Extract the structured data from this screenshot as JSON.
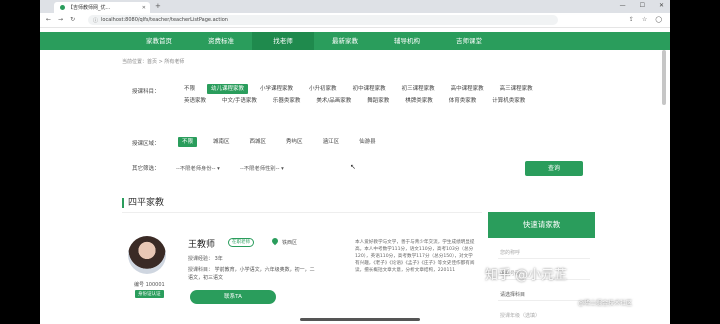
{
  "browser": {
    "tab_title": "【吉师教师网_优... ",
    "url": "localhost:8080/qlfs/teacher/teacherListPage.action"
  },
  "nav": [
    "家教首页",
    "资费标准",
    "找老师",
    "最新家教",
    "辅导机构",
    "吉师课堂"
  ],
  "breadcrumb": "当前位置：首页 > 所有老师",
  "filters": {
    "subject_label": "授课科目：",
    "subjects": [
      "不限",
      "幼儿课程家教",
      "小学课程家教",
      "小升初家教",
      "初中课程家教",
      "初三课程家教",
      "高中课程家教",
      "高三课程家教",
      "英语家教",
      "中文/手语家教",
      "乐器类家教",
      "美术/品画家教",
      "舞蹈家教",
      "棋牌类家教",
      "体育类家教",
      "计算机类家教"
    ],
    "area_label": "授课区域：",
    "areas": [
      "不限",
      "城南区",
      "西城区",
      "秀屿区",
      "涵江区",
      "仙游县"
    ],
    "other_label": "其它筛选：",
    "select_identity": "--不限老师身份--",
    "select_gender": "--不限老师性别--",
    "query_button": "查询"
  },
  "section_title": "四平家教",
  "teacher": {
    "name": "王教师",
    "badge": "在职老师",
    "location": "铁西区",
    "experience": "授课经验： 3年",
    "subjects_line1": "授课科目： 学前教育，小学语文，六年级奥数，初一，二",
    "subjects_line2": "语文，初三语文",
    "id": "编号 100001",
    "verified": "身份证认证",
    "contact": "联系TA",
    "description": "本人爱好教学与文学，善于与青少年交流，学生成绩明显提高。本人中考数学111分，语文110分，高考103分（总分120），英语110分，高考数学117分（总分150），对文学有兴趣，《老子》《论语》《孟子》《庄子》等文史佳作都有阅读，擅长概括文章大意，分析文章结构，220111"
  },
  "sidebar": {
    "title": "快速请家教",
    "fields": [
      "您的称呼",
      "手机号码",
      "请选择科目",
      "授课年级（选填）"
    ]
  },
  "watermark": "知乎 @小元芷",
  "watermark2": "@稀土掘金技术社区"
}
